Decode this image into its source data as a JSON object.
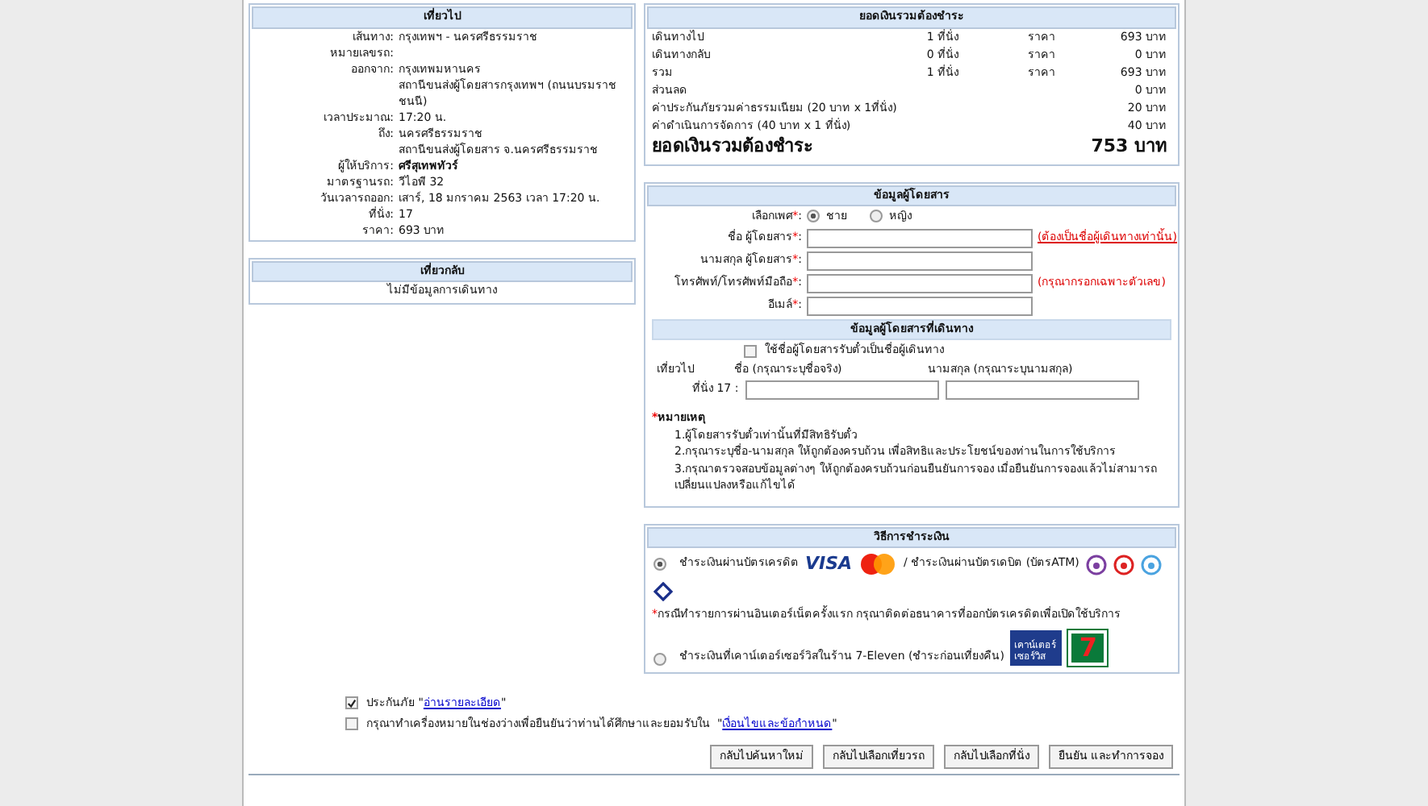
{
  "outbound": {
    "title": "เที่ยวไป",
    "rows": [
      {
        "label": "เส้นทาง:",
        "value": "กรุงเทพฯ - นครศรีธรรมราช"
      },
      {
        "label": "หมายเลขรถ:"
      },
      {
        "label": "ออกจาก:",
        "value": "กรุงเทพมหานคร"
      },
      {
        "value": "สถานีขนส่งผู้โดยสารกรุงเทพฯ (ถนนบรมราชชนนี)"
      },
      {
        "label": "เวลาประมาณ:",
        "value": "17:20 น."
      },
      {
        "label": "ถึง:",
        "value": "นครศรีธรรมราช"
      },
      {
        "value": "สถานีขนส่งผู้โดยสาร จ.นครศรีธรรมราช"
      },
      {
        "label": "ผู้ให้บริการ:",
        "value": "ศรีสุเทพทัวร์",
        "bold": true
      },
      {
        "label": "มาตรฐานรถ:",
        "value": "วีไอพี 32"
      },
      {
        "label": "วันเวลารถออก:",
        "value": "เสาร์, 18 มกราคม 2563 เวลา 17:20 น."
      },
      {
        "label": "ที่นั่ง:",
        "value": "17"
      },
      {
        "label": "ราคา:",
        "value": "693 บาท"
      }
    ]
  },
  "return": {
    "title": "เที่ยวกลับ",
    "message": "ไม่มีข้อมูลการเดินทาง"
  },
  "summary": {
    "title": "ยอดเงินรวมต้องชำระ",
    "rows": [
      {
        "label": "เดินทางไป",
        "seats": "1 ที่นั่ง",
        "price_label": "ราคา",
        "amount": "693 บาท"
      },
      {
        "label": "เดินทางกลับ",
        "seats": "0 ที่นั่ง",
        "price_label": "ราคา",
        "amount": "0 บาท"
      },
      {
        "label": "รวม",
        "seats": "1 ที่นั่ง",
        "price_label": "ราคา",
        "amount": "693 บาท"
      },
      {
        "label": "ส่วนลด",
        "amount": "0 บาท"
      },
      {
        "label": "ค่าประกันภัยรวมค่าธรรมเนียม (20 บาท x 1ที่นั่ง)",
        "amount": "20 บาท"
      },
      {
        "label": "ค่าดำเนินการจัดการ  (40 บาท x 1 ที่นั่ง)",
        "amount": "40 บาท"
      }
    ],
    "total_label": "ยอดเงินรวมต้องชำระ",
    "total": "753 บาท"
  },
  "passenger": {
    "title": "ข้อมูลผู้โดยสาร",
    "required": "*",
    "colon": ":",
    "gender_label": "เลือกเพศ",
    "genders": [
      {
        "label": "ชาย",
        "selected": true
      },
      {
        "label": "หญิง",
        "selected": false
      }
    ],
    "fields": [
      {
        "label": "ชื่อ ผู้โดยสาร",
        "hint": "(ต้องเป็นชื่อผู้เดินทางเท่านั้น)",
        "hint_link": true
      },
      {
        "label": "นามสกุล ผู้โดยสาร"
      },
      {
        "label": "โทรศัพท์/โทรศัพท์มือถือ",
        "hint": "(กรุณากรอกเฉพาะตัวเลข)",
        "hint_link": false
      },
      {
        "label": "อีเมล์"
      }
    ],
    "travellers_title": "ข้อมูลผู้โดยสารที่เดินทาง",
    "same_name": {
      "label": "ใช้ชื่อผู้โดยสารรับตั๋วเป็นชื่อผู้เดินทาง",
      "checked": false
    },
    "trip_label": "เที่ยวไป",
    "first_col": "ชื่อ (กรุณาระบุชื่อจริง)",
    "last_col": "นามสกุล (กรุณาระบุนามสกุล)",
    "seat_label": "ที่นั่ง 17 :",
    "notes_star": "*",
    "notes_title": "หมายเหตุ",
    "notes": [
      "1.ผู้โดยสารรับตั๋วเท่านั้นที่มีสิทธิรับตั๋ว",
      "2.กรุณาระบุชื่อ-นามสกุล ให้ถูกต้องครบถ้วน เพื่อสิทธิและประโยชน์ของท่านในการใช้บริการ",
      "3.กรุณาตรวจสอบข้อมูลต่างๆ ให้ถูกต้องครบถ้วนก่อนยืนยันการจอง เมื่อยืนยันการจองแล้วไม่สามารถเปลี่ยนแปลงหรือแก้ไขได้"
    ]
  },
  "payment": {
    "title": "วิธีการชำระเงิน",
    "options": [
      {
        "kind": "card",
        "selected": true,
        "label": "ชำระเงินผ่านบัตรเครดิต",
        "visa": "VISA",
        "debit": "/ ชำระเงินผ่านบัตรเดบิต (บัตรATM)",
        "note_star": "*",
        "note": "กรณีทำรายการผ่านอินเตอร์เน็ตครั้งแรก กรุณาติดต่อธนาคารที่ออกบัตรเครดิตเพื่อเปิดใช้บริการ"
      },
      {
        "kind": "counter",
        "selected": false,
        "label": "ชำระเงินที่เคาน์เตอร์เซอร์วิสในร้าน 7-Eleven (ชำระก่อนเที่ยงคืน)",
        "logo_text": "เคาน์เตอร์เซอร์วิส",
        "seven": "7"
      }
    ]
  },
  "agreements": [
    {
      "checked": true,
      "text": "ประกันภัย \"",
      "link": "อ่านรายละเอียด",
      "close": "\""
    },
    {
      "checked": false,
      "text": "กรุณาทำเครื่องหมายในช่องว่างเพื่อยืนยันว่าท่านได้ศึกษาและยอมรับใน  \"",
      "link": "เงื่อนไขและข้อกำหนด",
      "close": "\""
    }
  ],
  "buttons": [
    "กลับไปค้นหาใหม่",
    "กลับไปเลือกเที่ยวรถ",
    "กลับไปเลือกที่นั่ง",
    "ยืนยัน และทำการจอง"
  ]
}
